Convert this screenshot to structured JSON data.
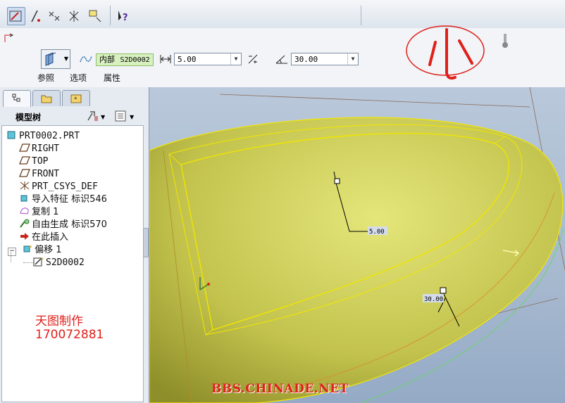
{
  "dashboard": {
    "mode_label": "内部",
    "sketch_name": "S2D0002",
    "offset_value": "5.00",
    "angle_value": "30.00",
    "tabs": [
      "参照",
      "选项",
      "属性"
    ]
  },
  "model_tree": {
    "title": "模型树",
    "nodes": [
      {
        "label": "PRT0002.PRT",
        "icon": "part-icon"
      },
      {
        "label": "RIGHT",
        "icon": "datum-plane-icon"
      },
      {
        "label": "TOP",
        "icon": "datum-plane-icon"
      },
      {
        "label": "FRONT",
        "icon": "datum-plane-icon"
      },
      {
        "label": "PRT_CSYS_DEF",
        "icon": "csys-icon"
      },
      {
        "label": "导入特征 标识546",
        "icon": "import-feature-icon"
      },
      {
        "label": "复制 1",
        "icon": "copy-surface-icon"
      },
      {
        "label": "自由生成 标识570",
        "icon": "freestyle-icon"
      },
      {
        "label": "在此插入",
        "icon": "insert-here-arrow-icon"
      },
      {
        "label": "偏移 1",
        "icon": "offset-feature-icon"
      },
      {
        "label": "S2D0002",
        "icon": "sketch-icon"
      }
    ]
  },
  "annotations": {
    "handwritten_char": "小",
    "maker_text": "天图制作",
    "maker_id": "170072881",
    "site_watermark": "BBS.CHINADE.NET"
  },
  "viewport": {
    "dim_offset": "5.00",
    "dim_angle": "30.00"
  },
  "colors": {
    "surface": "#c9c95a",
    "surface_edge": "#f2e600",
    "watermark": "#e0201a"
  }
}
